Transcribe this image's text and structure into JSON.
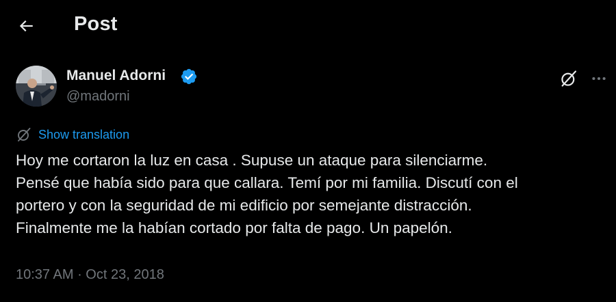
{
  "header": {
    "title": "Post",
    "back_icon": "arrow-left-icon"
  },
  "author": {
    "name": "Manuel Adorni",
    "handle": "@madorni",
    "verified": true,
    "verified_color": "#1d9bf0",
    "avatar_icon": "profile-avatar"
  },
  "actions": {
    "grok_icon": "grok-icon",
    "more_icon": "more-horizontal-icon"
  },
  "translation": {
    "label": "Show translation",
    "icon": "translate-icon",
    "color": "#1d9bf0"
  },
  "tweet": {
    "text": "Hoy me cortaron la luz en casa . Supuse un ataque para silenciarme.\nPensé que había sido para que callara. Temí por mi familia. Discutí con el\nportero y con la seguridad de mi edificio por semejante distracción.\nFinalmente me la habían cortado por falta de pago. Un papelón."
  },
  "meta": {
    "time": "10:37 AM",
    "separator": " · ",
    "date": "Oct 23, 2018"
  },
  "colors": {
    "background": "#000000",
    "text_primary": "#e7e9ea",
    "text_secondary": "#71767b",
    "accent": "#1d9bf0"
  }
}
